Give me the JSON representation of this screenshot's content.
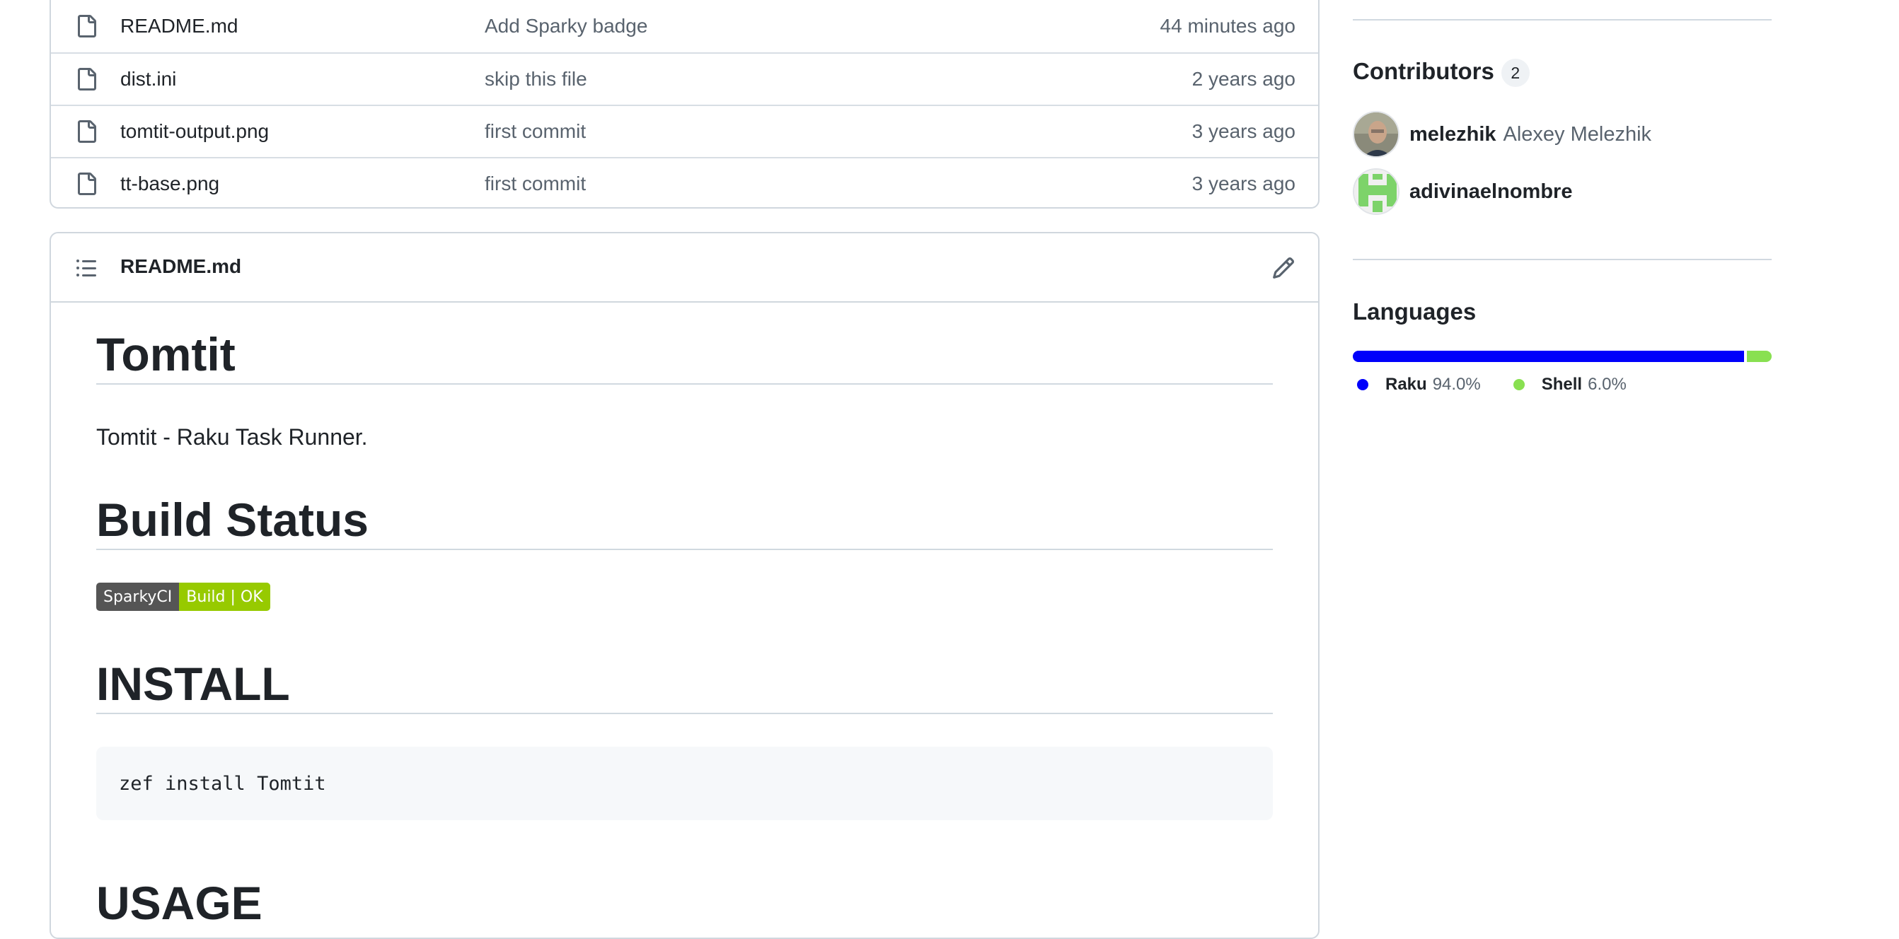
{
  "files": [
    {
      "name": "README.md",
      "message": "Add Sparky badge",
      "time": "44 minutes ago"
    },
    {
      "name": "dist.ini",
      "message": "skip this file",
      "time": "2 years ago"
    },
    {
      "name": "tomtit-output.png",
      "message": "first commit",
      "time": "3 years ago"
    },
    {
      "name": "tt-base.png",
      "message": "first commit",
      "time": "3 years ago"
    }
  ],
  "readme": {
    "file_label": "README.md",
    "title": "Tomtit",
    "intro": "Tomtit - Raku Task Runner.",
    "build_status_heading": "Build Status",
    "badge": {
      "left": "SparkyCI",
      "right": "Build | OK"
    },
    "install_heading": "INSTALL",
    "install_code": "zef install Tomtit",
    "usage_heading": "USAGE"
  },
  "sidebar": {
    "contributors_heading": "Contributors",
    "contributors_count": "2",
    "contributors": [
      {
        "login": "melezhik",
        "name": "Alexey Melezhik"
      },
      {
        "login": "adivinaelnombre",
        "name": ""
      }
    ],
    "languages_heading": "Languages",
    "languages": [
      {
        "name": "Raku",
        "percent": "94.0%",
        "value": 94.0,
        "color": "#0000fb"
      },
      {
        "name": "Shell",
        "percent": "6.0%",
        "value": 6.0,
        "color": "#89e051"
      }
    ]
  }
}
